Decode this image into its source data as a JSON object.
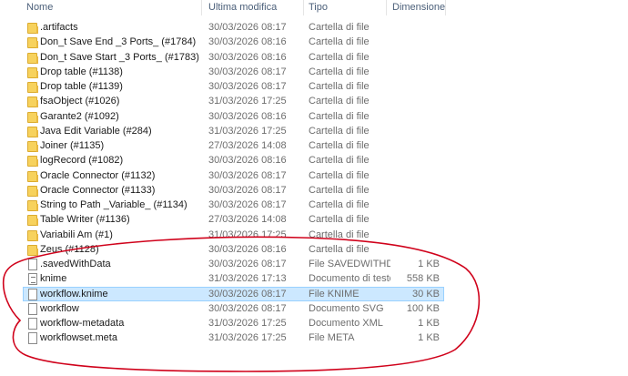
{
  "columns": {
    "name": "Nome",
    "modified": "Ultima modifica",
    "type": "Tipo",
    "size": "Dimensione"
  },
  "rows": [
    {
      "name": ".artifacts",
      "date": "30/03/2026 08:17",
      "type": "Cartella di file",
      "size": "",
      "icon": "folder-icon"
    },
    {
      "name": "Don_t Save End _3 Ports_ (#1784)",
      "date": "30/03/2026 08:16",
      "type": "Cartella di file",
      "size": "",
      "icon": "folder-icon"
    },
    {
      "name": "Don_t Save Start _3 Ports_ (#1783)",
      "date": "30/03/2026 08:16",
      "type": "Cartella di file",
      "size": "",
      "icon": "folder-icon"
    },
    {
      "name": "Drop table (#1138)",
      "date": "30/03/2026 08:17",
      "type": "Cartella di file",
      "size": "",
      "icon": "folder-icon"
    },
    {
      "name": "Drop table (#1139)",
      "date": "30/03/2026 08:17",
      "type": "Cartella di file",
      "size": "",
      "icon": "folder-icon"
    },
    {
      "name": "fsaObject (#1026)",
      "date": "31/03/2026 17:25",
      "type": "Cartella di file",
      "size": "",
      "icon": "folder-icon"
    },
    {
      "name": "Garante2 (#1092)",
      "date": "30/03/2026 08:16",
      "type": "Cartella di file",
      "size": "",
      "icon": "folder-icon"
    },
    {
      "name": "Java Edit Variable (#284)",
      "date": "31/03/2026 17:25",
      "type": "Cartella di file",
      "size": "",
      "icon": "folder-icon"
    },
    {
      "name": "Joiner (#1135)",
      "date": "27/03/2026 14:08",
      "type": "Cartella di file",
      "size": "",
      "icon": "folder-icon"
    },
    {
      "name": "logRecord (#1082)",
      "date": "30/03/2026 08:16",
      "type": "Cartella di file",
      "size": "",
      "icon": "folder-icon"
    },
    {
      "name": "Oracle Connector (#1132)",
      "date": "30/03/2026 08:17",
      "type": "Cartella di file",
      "size": "",
      "icon": "folder-icon"
    },
    {
      "name": "Oracle Connector (#1133)",
      "date": "30/03/2026 08:17",
      "type": "Cartella di file",
      "size": "",
      "icon": "folder-icon"
    },
    {
      "name": "String to Path _Variable_ (#1134)",
      "date": "30/03/2026 08:17",
      "type": "Cartella di file",
      "size": "",
      "icon": "folder-icon"
    },
    {
      "name": "Table Writer (#1136)",
      "date": "27/03/2026 14:08",
      "type": "Cartella di file",
      "size": "",
      "icon": "folder-icon"
    },
    {
      "name": "Variabili Am (#1)",
      "date": "31/03/2026 17:25",
      "type": "Cartella di file",
      "size": "",
      "icon": "folder-icon"
    },
    {
      "name": "Zeus (#1128)",
      "date": "30/03/2026 08:16",
      "type": "Cartella di file",
      "size": "",
      "icon": "folder-icon"
    },
    {
      "name": ".savedWithData",
      "date": "30/03/2026 08:17",
      "type": "File SAVEDWITHD...",
      "size": "1 KB",
      "icon": "file-icon"
    },
    {
      "name": "knime",
      "date": "31/03/2026 17:13",
      "type": "Documento di testo",
      "size": "558 KB",
      "icon": "text-file-icon"
    },
    {
      "name": "workflow.knime",
      "date": "30/03/2026 08:17",
      "type": "File KNIME",
      "size": "30 KB",
      "icon": "file-icon",
      "selected": true
    },
    {
      "name": "workflow",
      "date": "30/03/2026 08:17",
      "type": "Documento SVG",
      "size": "100 KB",
      "icon": "file-icon"
    },
    {
      "name": "workflow-metadata",
      "date": "31/03/2026 17:25",
      "type": "Documento XML",
      "size": "1 KB",
      "icon": "file-icon"
    },
    {
      "name": "workflowset.meta",
      "date": "31/03/2026 17:25",
      "type": "File META",
      "size": "1 KB",
      "icon": "file-icon"
    }
  ],
  "colors": {
    "selection_bg": "#cce8ff",
    "selection_border": "#99d1ff",
    "header_text": "#4c607a",
    "annotation": "#d0021b",
    "folder": "#f7d25d"
  }
}
